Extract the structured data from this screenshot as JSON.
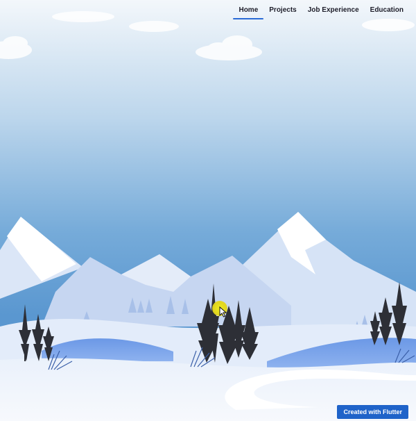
{
  "nav": {
    "items": [
      {
        "label": "Home",
        "active": true
      },
      {
        "label": "Projects",
        "active": false
      },
      {
        "label": "Job Experience",
        "active": false
      },
      {
        "label": "Education",
        "active": false
      }
    ]
  },
  "footer": {
    "cta_label": "Created with Flutter"
  },
  "colors": {
    "sky_top": "#f3f7fb",
    "sky_bottom": "#5a97d0",
    "snow": "#ffffff",
    "mountain": "#c9d8f2",
    "tree": "#2d2f36",
    "accent": "#1f63c9"
  },
  "icons": {
    "cursor": "pointer-cursor-icon"
  }
}
